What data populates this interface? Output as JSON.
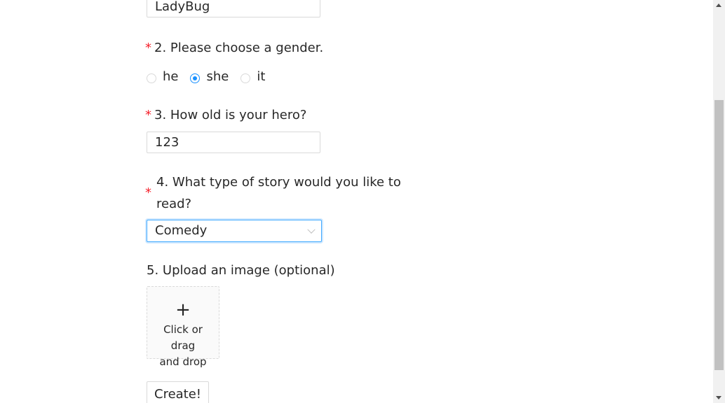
{
  "form": {
    "q1": {
      "value": "LadyBug"
    },
    "q2": {
      "required_mark": "*",
      "label": "2. Please choose a gender.",
      "options": [
        {
          "label": "he",
          "checked": false
        },
        {
          "label": "she",
          "checked": true
        },
        {
          "label": "it",
          "checked": false
        }
      ]
    },
    "q3": {
      "required_mark": "*",
      "label": "3. How old is your hero?",
      "value": "123"
    },
    "q4": {
      "required_mark": "*",
      "label_line1": "4. What type of story would you like to",
      "label_line2": "read?",
      "selected": "Comedy"
    },
    "q5": {
      "label": "5. Upload an image (optional)",
      "upload_plus": "+",
      "upload_text_line1": "Click or drag",
      "upload_text_line2": "and drop"
    },
    "submit_label": "Create!"
  },
  "colors": {
    "required": "#f5222d",
    "accent": "#1890ff",
    "border": "#d9d9d9"
  }
}
